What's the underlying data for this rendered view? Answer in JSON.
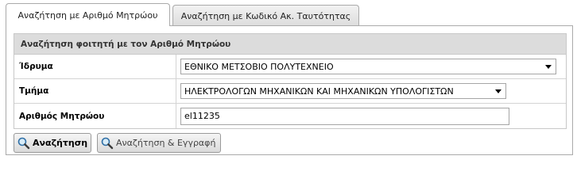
{
  "tabs": [
    {
      "label": "Αναζήτηση με Αριθμό Μητρώου",
      "active": true
    },
    {
      "label": "Αναζήτηση με Κωδικό Ακ. Ταυτότητας",
      "active": false
    }
  ],
  "form": {
    "header": "Αναζήτηση φοιτητή με τον Αριθμό Μητρώου",
    "rows": [
      {
        "label": "Ίδρυμα",
        "value": "ΕΘΝΙΚΟ ΜΕΤΣΟΒΙΟ ΠΟΛΥΤΕΧΝΕΙΟ",
        "type": "select"
      },
      {
        "label": "Τμήμα",
        "value": "ΗΛΕΚΤΡΟΛΟΓΩΝ ΜΗΧΑΝΙΚΩΝ ΚΑΙ ΜΗΧΑΝΙΚΩΝ ΥΠΟΛΟΓΙΣΤΩΝ",
        "type": "select"
      },
      {
        "label": "Αριθμός Μητρώου",
        "value": "el11235",
        "type": "text"
      }
    ]
  },
  "buttons": {
    "search_label": "Αναζήτηση",
    "search_register_label": "Αναζήτηση & Εγγραφή",
    "icon": "magnifier-icon"
  }
}
